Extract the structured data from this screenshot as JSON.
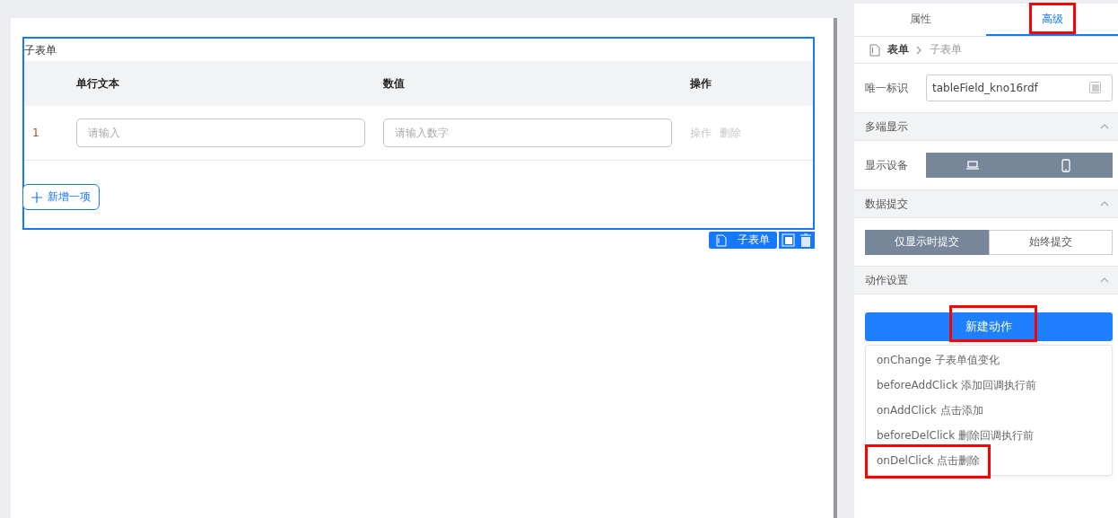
{
  "canvas": {
    "subform": {
      "label": "子表单",
      "columns": [
        "单行文本",
        "数值",
        "操作"
      ],
      "rows": [
        {
          "index": "1",
          "fields": [
            {
              "placeholder": "请输入"
            },
            {
              "placeholder": "请输入数字"
            }
          ],
          "actions": [
            {
              "label": "操作",
              "disabled": true
            },
            {
              "label": "删除",
              "disabled": true
            }
          ]
        }
      ],
      "add_button": "新增一项",
      "selected": true,
      "toolbar_tag": "子表单"
    }
  },
  "panel": {
    "tabs": [
      {
        "label": "属性",
        "selected": false,
        "highlighted": false
      },
      {
        "label": "高级",
        "selected": true,
        "highlighted": true
      }
    ],
    "breadcrumb": [
      "表单",
      "子表单"
    ],
    "id_field": {
      "label": "唯一标识",
      "value": "tableField_kno16rdf"
    },
    "multi_display": {
      "title": "多端显示",
      "expanded": true,
      "label": "显示设备",
      "devices": [
        {
          "kind": "desktop",
          "selected": true
        },
        {
          "kind": "mobile",
          "selected": true
        }
      ]
    },
    "data_submit": {
      "title": "数据提交",
      "expanded": true,
      "options": [
        {
          "label": "仅显示时提交",
          "selected": true
        },
        {
          "label": "始终提交",
          "selected": false
        }
      ]
    },
    "actions": {
      "title": "动作设置",
      "expanded": true,
      "button": {
        "label": "新建动作",
        "highlighted": true
      },
      "menu": [
        {
          "label": "onChange 子表单值变化",
          "highlighted": false
        },
        {
          "label": "beforeAddClick 添加回调执行前",
          "highlighted": false
        },
        {
          "label": "onAddClick 点击添加",
          "highlighted": false
        },
        {
          "label": "beforeDelClick 删除回调执行前",
          "highlighted": false
        },
        {
          "label": "onDelClick 点击删除",
          "highlighted": true
        }
      ]
    }
  }
}
